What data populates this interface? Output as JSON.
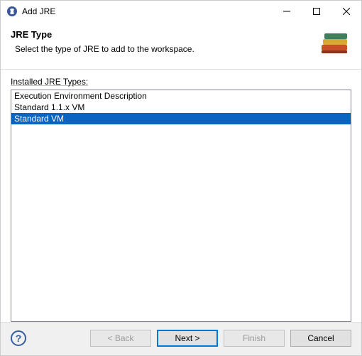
{
  "window": {
    "title": "Add JRE"
  },
  "header": {
    "title": "JRE Type",
    "description": "Select the type of JRE to add to the workspace."
  },
  "content": {
    "list_label": "Installed JRE Types:",
    "items": [
      {
        "label": "Execution Environment Description",
        "selected": false
      },
      {
        "label": "Standard 1.1.x VM",
        "selected": false
      },
      {
        "label": "Standard VM",
        "selected": true
      }
    ]
  },
  "buttons": {
    "back": "< Back",
    "next": "Next >",
    "finish": "Finish",
    "cancel": "Cancel",
    "help": "?"
  }
}
